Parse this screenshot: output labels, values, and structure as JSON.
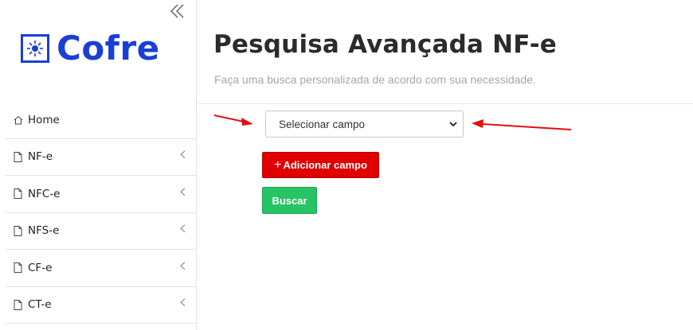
{
  "app": {
    "logo_text": "Cofre",
    "brand_color": "#1a3fd6"
  },
  "sidebar": {
    "collapse_icon": "double-chevron-left-icon",
    "items": [
      {
        "label": "Home",
        "icon": "home-icon",
        "has_submenu": false
      },
      {
        "label": "NF-e",
        "icon": "file-icon",
        "has_submenu": true
      },
      {
        "label": "NFC-e",
        "icon": "file-icon",
        "has_submenu": true
      },
      {
        "label": "NFS-e",
        "icon": "file-icon",
        "has_submenu": true
      },
      {
        "label": "CF-e",
        "icon": "file-icon",
        "has_submenu": true
      },
      {
        "label": "CT-e",
        "icon": "file-icon",
        "has_submenu": true
      }
    ]
  },
  "main": {
    "title": "Pesquisa Avançada NF-e",
    "subtitle": "Faça uma busca personalizada de acordo com sua necessidade.",
    "field_select": {
      "selected": "Selecionar campo"
    },
    "add_button": {
      "label": "Adicionar campo",
      "color": "#e00000"
    },
    "search_button": {
      "label": "Buscar",
      "color": "#27c466"
    }
  },
  "annotations": {
    "arrow_color": "#e01010"
  }
}
